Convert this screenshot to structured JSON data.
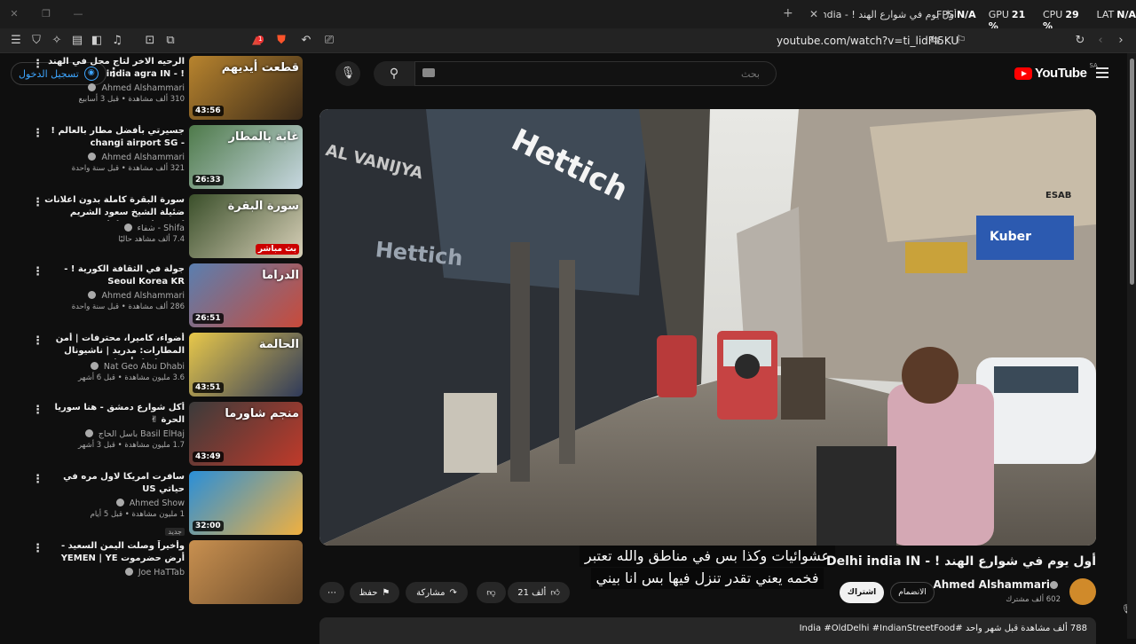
{
  "browser": {
    "tab_title": "أول يوم في شوارع الهند ! - ‎india",
    "tab_close": "✕",
    "new_tab": "+",
    "url": "youtube.com/watch?v=ti_lidFI5KU",
    "overlay": [
      {
        "key": "FPS",
        "val": "N/A"
      },
      {
        "key": "GPU",
        "val": "21 %"
      },
      {
        "key": "CPU",
        "val": "29 %"
      },
      {
        "key": "LAT",
        "val": "N/A"
      }
    ],
    "tab_badge": "1"
  },
  "header": {
    "sign_in": "تسجيل الدخول",
    "search_placeholder": "بحث",
    "logo_text": "YouTube",
    "region": "SA"
  },
  "recommendations": [
    {
      "title": "الرحيه الاخر لتاج محل في الهند ! - india agra IN",
      "channel": "Ahmed Alshammari",
      "stats": "310 ألف مشاهدة • قبل 3 أسابيع",
      "duration": "43:56",
      "tag": "قطعت أيديهم",
      "c1": "#b8842e",
      "c2": "#3b2a18"
    },
    {
      "title": "جسيرتي بأفضل مطار بالعالم ! - changi airport SG",
      "channel": "Ahmed Alshammari",
      "stats": "321 ألف مشاهدة • قبل سنة واحدة",
      "duration": "26:33",
      "tag": "غابة بالمطار",
      "c1": "#4e7a4a",
      "c2": "#c7d7e0"
    },
    {
      "title": "سورة البقرة كاملة بدون اعلانات ضئيلة الشيخ سعود الشريم surah baqarah saud ...",
      "channel": "Shifa - شفاء",
      "stats": "7.4 ألف مشاهد حاليًا",
      "duration": "",
      "tag": "سورة البقرة",
      "live": "بث مباشر",
      "c1": "#3a4f2a",
      "c2": "#d8d0b8"
    },
    {
      "title": "جولة في الثقافة الكورية ! - Seoul Korea KR",
      "channel": "Ahmed Alshammari",
      "stats": "286 ألف مشاهدة • قبل سنة واحدة",
      "duration": "26:51",
      "tag": "الدراما",
      "c1": "#5a7fb0",
      "c2": "#c94a3a"
    },
    {
      "title": "أضواء، كاميرا، محترفات | أمن المطارات: مدريد | ناشيونال جيوغرافيك أبوظبي",
      "channel": "Nat Geo Abu Dhabi",
      "stats": "3.6 مليون مشاهدة • قبل 6 أشهر",
      "duration": "43:51",
      "tag": "الحالمة",
      "c1": "#e8c84a",
      "c2": "#2f3a5a"
    },
    {
      "title": "أكل شوارع دمشق - هنا سوريا الحرة ✌",
      "channel": "Basil ElHaj باسل الحاج",
      "stats": "1.7 مليون مشاهدة • قبل 3 أشهر",
      "duration": "43:49",
      "tag": "منجم شاورما",
      "c1": "#3b3b3b",
      "c2": "#c03a2a"
    },
    {
      "title": "سافرت امريكا لاول مره في حياتي US",
      "channel": "Ahmed Show",
      "stats": "1 مليون مشاهدة • قبل 5 أيام",
      "duration": "32:00",
      "tag": "",
      "new": "جديد",
      "c1": "#2a8fd8",
      "c2": "#f0b040"
    },
    {
      "title": "وأخيراً وصلت اليمن السعيد - أرض حضرموت YEMEN | YE",
      "channel": "Joe HaTTab",
      "stats": "",
      "duration": "",
      "tag": "",
      "c1": "#c89050",
      "c2": "#6a4a2a"
    }
  ],
  "player": {
    "subtitle_lines": [
      "عشوائيات وكذا بس في مناطق والله تعتبر",
      "فخمه يعني تقدر تنزل فيها بس انا بيني"
    ],
    "scene_texts": [
      "Hettich",
      "Hettich",
      "VANIJYA",
      "ESAB",
      "Kuber",
      "AL VANIJYA"
    ]
  },
  "video": {
    "title": "أول يوم في شوارع الهند ! - Delhi india IN",
    "channel": "Ahmed Alshammari",
    "subscribers": "602 ألف مشترك",
    "join": "الانضمام",
    "subscribe": "اشتراك",
    "likes": "21 ألف",
    "share": "مشاركة",
    "save": "حفظ",
    "description": "788 ألف مشاهدة  قبل شهر واحد  #India #OldDelhi #IndianStreetFood"
  }
}
